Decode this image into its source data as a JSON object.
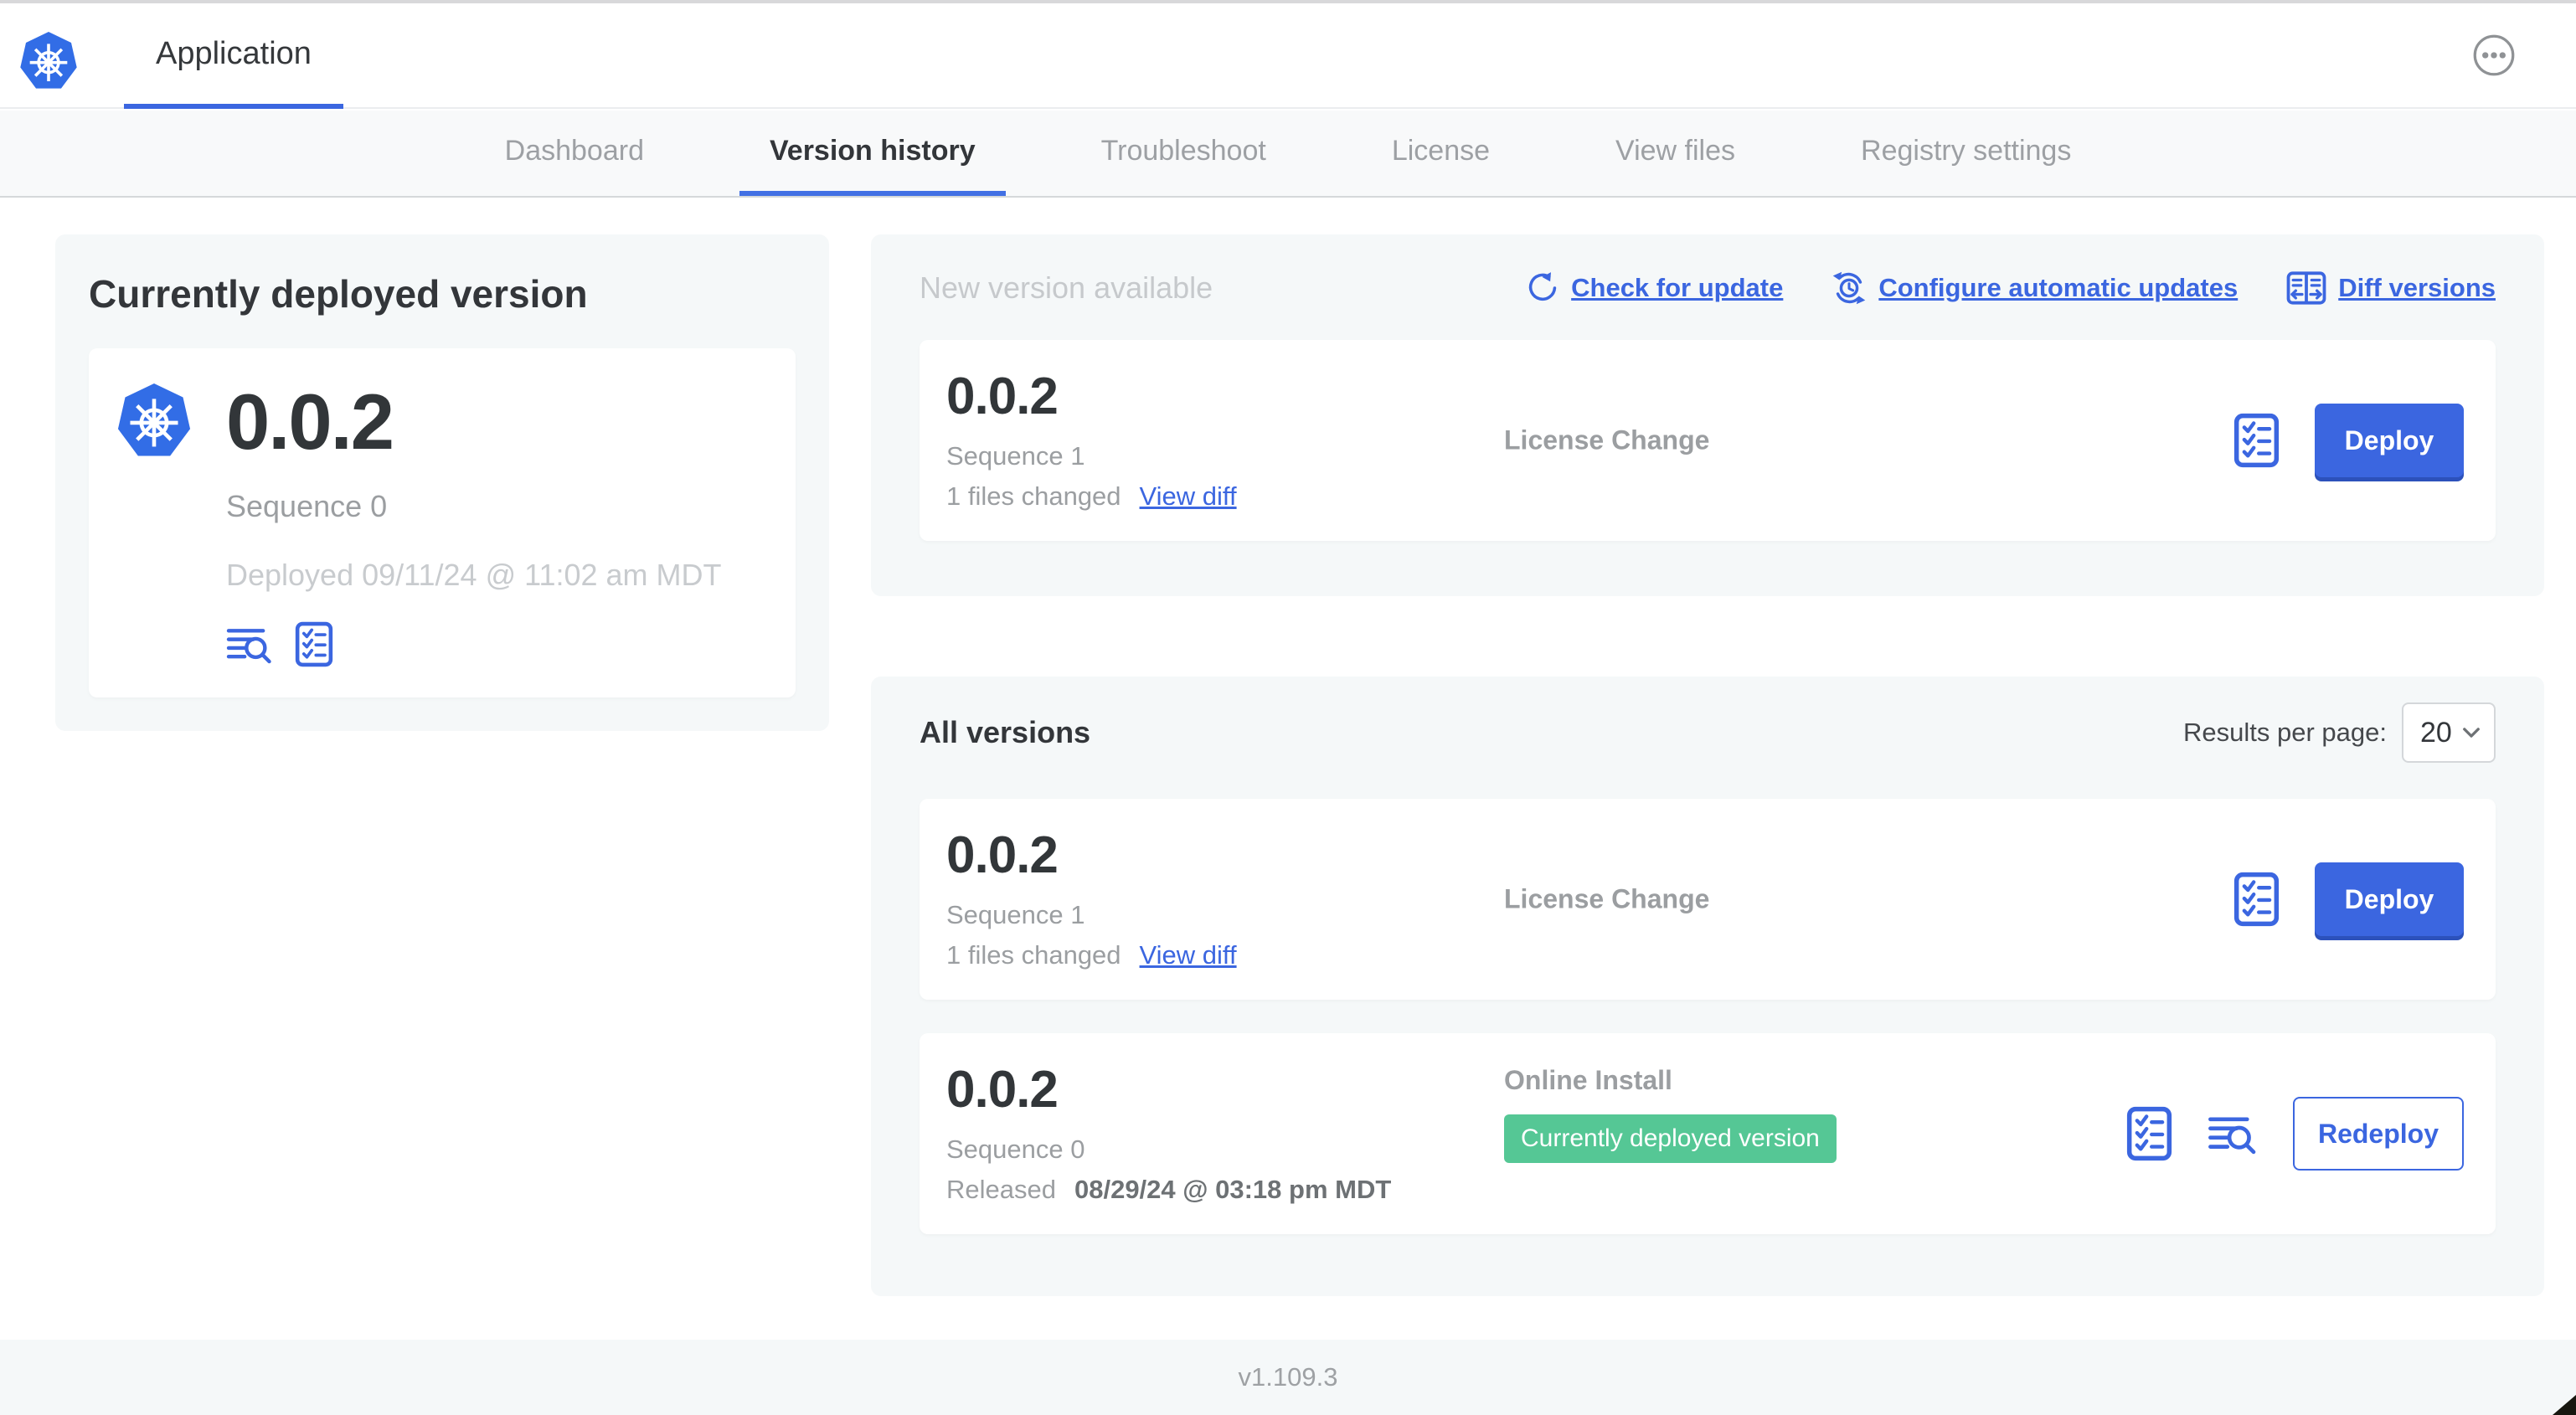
{
  "colors": {
    "accent_blue": "#3b66e0",
    "kubernetes_blue": "#326de6",
    "badge_green": "#55c795",
    "panel_gray": "#f5f8f9",
    "muted_text": "#c6c9cc",
    "gray_text": "#9b9ea1"
  },
  "header": {
    "app_title": "Application",
    "overflow_menu_icon": "ellipsis-icon"
  },
  "tabs": [
    {
      "label": "Dashboard",
      "active": false
    },
    {
      "label": "Version history",
      "active": true
    },
    {
      "label": "Troubleshoot",
      "active": false
    },
    {
      "label": "License",
      "active": false
    },
    {
      "label": "View files",
      "active": false
    },
    {
      "label": "Registry settings",
      "active": false
    }
  ],
  "deployed_panel": {
    "title": "Currently deployed version",
    "version": "0.0.2",
    "sequence": "Sequence 0",
    "deployed_timestamp": "Deployed 09/11/24 @ 11:02 am MDT",
    "icons": [
      "logs-icon",
      "preflight-checklist-icon"
    ]
  },
  "new_version_panel": {
    "title": "New version available",
    "actions": [
      {
        "label": "Check for update",
        "icon": "refresh-icon"
      },
      {
        "label": "Configure automatic updates",
        "icon": "auto-update-clock-icon"
      },
      {
        "label": "Diff versions",
        "icon": "diff-icon"
      }
    ],
    "row": {
      "version": "0.0.2",
      "sequence": "Sequence 1",
      "files_changed": "1 files changed",
      "view_diff_label": "View diff",
      "source": "License Change",
      "deploy_label": "Deploy",
      "icons": [
        "preflight-checklist-icon"
      ]
    }
  },
  "all_versions_panel": {
    "title": "All versions",
    "results_per_page_label": "Results per page:",
    "results_per_page_value": "20",
    "rows": [
      {
        "version": "0.0.2",
        "sequence": "Sequence 1",
        "files_changed": "1 files changed",
        "view_diff_label": "View diff",
        "source": "License Change",
        "deploy_label": "Deploy",
        "icons": [
          "preflight-checklist-icon"
        ]
      },
      {
        "version": "0.0.2",
        "sequence": "Sequence 0",
        "released_prefix": "Released",
        "released_timestamp": "08/29/24 @ 03:18 pm MDT",
        "source": "Online Install",
        "status_badge": "Currently deployed version",
        "redeploy_label": "Redeploy",
        "icons": [
          "preflight-checklist-icon",
          "logs-icon"
        ]
      }
    ]
  },
  "footer": {
    "kots_version": "v1.109.3"
  }
}
